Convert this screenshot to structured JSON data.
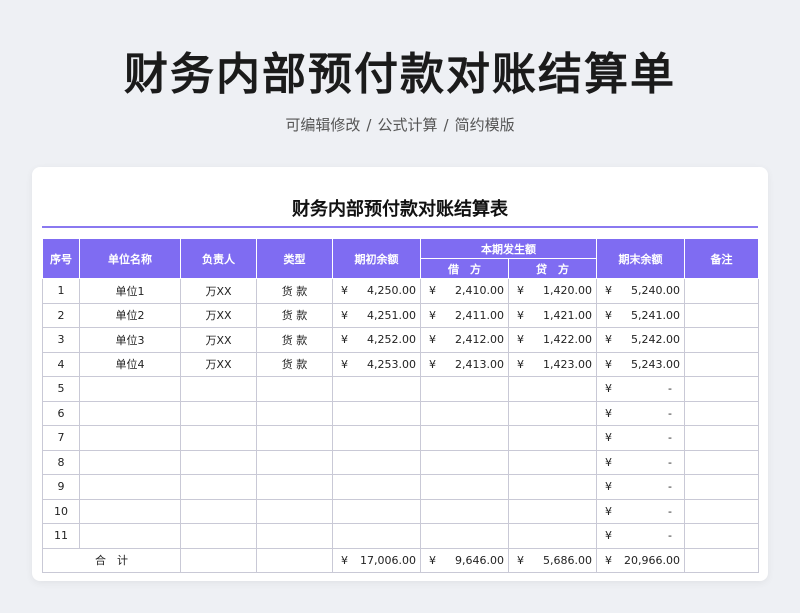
{
  "page": {
    "title": "财务内部预付款对账结算单",
    "subtitle_parts": [
      "可编辑修改",
      "公式计算",
      "简约模版"
    ],
    "subtitle_sep": "/"
  },
  "sheet": {
    "title": "财务内部预付款对账结算表",
    "headers": {
      "seq": "序号",
      "unit": "单位名称",
      "person": "负责人",
      "type": "类型",
      "opening": "期初余额",
      "period": "本期发生额",
      "debit": "借　方",
      "credit": "贷　方",
      "closing": "期末余额",
      "remark": "备注"
    },
    "currency": "¥",
    "rows": [
      {
        "seq": "1",
        "unit": "单位1",
        "person": "万XX",
        "type": "货 款",
        "opening": "4,250.00",
        "debit": "2,410.00",
        "credit": "1,420.00",
        "closing": "5,240.00",
        "remark": ""
      },
      {
        "seq": "2",
        "unit": "单位2",
        "person": "万XX",
        "type": "货 款",
        "opening": "4,251.00",
        "debit": "2,411.00",
        "credit": "1,421.00",
        "closing": "5,241.00",
        "remark": ""
      },
      {
        "seq": "3",
        "unit": "单位3",
        "person": "万XX",
        "type": "货 款",
        "opening": "4,252.00",
        "debit": "2,412.00",
        "credit": "1,422.00",
        "closing": "5,242.00",
        "remark": ""
      },
      {
        "seq": "4",
        "unit": "单位4",
        "person": "万XX",
        "type": "货 款",
        "opening": "4,253.00",
        "debit": "2,413.00",
        "credit": "1,423.00",
        "closing": "5,243.00",
        "remark": ""
      },
      {
        "seq": "5",
        "unit": "",
        "person": "",
        "type": "",
        "opening": "",
        "debit": "",
        "credit": "",
        "closing": "-",
        "remark": ""
      },
      {
        "seq": "6",
        "unit": "",
        "person": "",
        "type": "",
        "opening": "",
        "debit": "",
        "credit": "",
        "closing": "-",
        "remark": ""
      },
      {
        "seq": "7",
        "unit": "",
        "person": "",
        "type": "",
        "opening": "",
        "debit": "",
        "credit": "",
        "closing": "-",
        "remark": ""
      },
      {
        "seq": "8",
        "unit": "",
        "person": "",
        "type": "",
        "opening": "",
        "debit": "",
        "credit": "",
        "closing": "-",
        "remark": ""
      },
      {
        "seq": "9",
        "unit": "",
        "person": "",
        "type": "",
        "opening": "",
        "debit": "",
        "credit": "",
        "closing": "-",
        "remark": ""
      },
      {
        "seq": "10",
        "unit": "",
        "person": "",
        "type": "",
        "opening": "",
        "debit": "",
        "credit": "",
        "closing": "-",
        "remark": ""
      },
      {
        "seq": "11",
        "unit": "",
        "person": "",
        "type": "",
        "opening": "",
        "debit": "",
        "credit": "",
        "closing": "-",
        "remark": ""
      }
    ],
    "total": {
      "label": "合　计",
      "opening": "17,006.00",
      "debit": "9,646.00",
      "credit": "5,686.00",
      "closing": "20,966.00"
    }
  },
  "colors": {
    "accent": "#7f6cf2",
    "rule": "#8a79f0",
    "background": "#eef0f4"
  }
}
